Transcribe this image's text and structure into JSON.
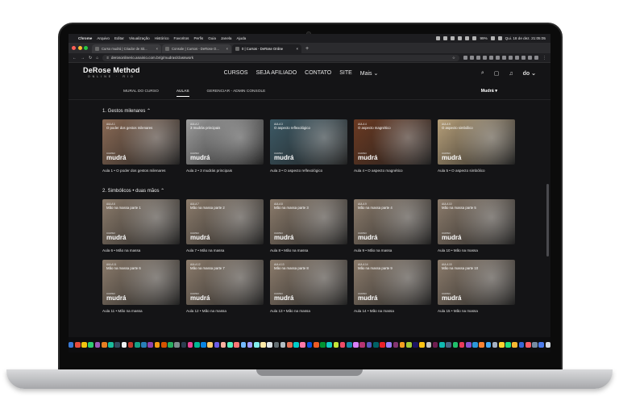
{
  "menubar": {
    "app": "Chrome",
    "items": [
      "Arquivo",
      "Editar",
      "Visualização",
      "Histórico",
      "Favoritos",
      "Perfis",
      "Guia",
      "Janela",
      "Ajuda"
    ],
    "battery": "99%",
    "datetime": "Qui. 18 de dez.  21:05:05"
  },
  "browser": {
    "tabs": [
      {
        "title": "Curso mudrá | Criador de Sit..."
      },
      {
        "title": "Console | Cursos - DeRose O..."
      },
      {
        "title": "0 | Cursos - DeRose Online"
      }
    ],
    "active_tab": 2,
    "url": "derosonlinerio.anainio.com.br/g/mudras/classwork"
  },
  "site": {
    "logo": "DeRose Method",
    "logo_sub": "ONLINE · RIO",
    "nav": [
      "CURSOS",
      "SEJA AFILIADO",
      "CONTATO",
      "SITE"
    ],
    "more": "Mais",
    "user": "do",
    "subnav": [
      "MURAL DO CURSO",
      "AULAS",
      "GERENCIAR - ADMIN CONSOLE"
    ],
    "course_select": "Mudrá"
  },
  "sections": [
    {
      "title": "1. Gestos milenares",
      "rows": [
        [
          {
            "tag": "AULA 1",
            "title": "O poder dos gestos milenares",
            "cur": "CURSO",
            "name": "mudrá",
            "caption": "Aula 1 • O poder dos gestos milenares",
            "color": "#8a6a55"
          },
          {
            "tag": "AULA 2",
            "title": "3 mudrás principais",
            "cur": "CURSO",
            "name": "mudrá",
            "caption": "Aula 2 • 3 mudrás principais",
            "color": "#9c9c9c"
          },
          {
            "tag": "AULA 3",
            "title": "O aspecto reflexológico",
            "cur": "CURSO",
            "name": "mudrá",
            "caption": "Aula 3 • O aspecto reflexológico",
            "color": "#3d5a66"
          },
          {
            "tag": "AULA 4",
            "title": "O aspecto magnético",
            "cur": "CURSO",
            "name": "mudrá",
            "caption": "Aula 4 • O aspecto magnético",
            "color": "#6b3a22"
          },
          {
            "tag": "AULA 5",
            "title": "O aspecto simbólico",
            "cur": "CURSO",
            "name": "mudrá",
            "caption": "Aula 5 • O aspecto simbólico",
            "color": "#b7a07a"
          }
        ]
      ]
    },
    {
      "title": "2. Simbólicos • duas mãos",
      "rows": [
        [
          {
            "tag": "AULA 6",
            "title": "Mão na massa parte 1",
            "cur": "CURSO",
            "name": "mudrá",
            "caption": "Aula 6 • Mão na massa",
            "color": "#8c7c6c"
          },
          {
            "tag": "AULA 7",
            "title": "Mão na massa parte 2",
            "cur": "CURSO",
            "name": "mudrá",
            "caption": "Aula 7 • Mão na massa",
            "color": "#8c7c6c"
          },
          {
            "tag": "AULA 8",
            "title": "Mão na massa parte 3",
            "cur": "CURSO",
            "name": "mudrá",
            "caption": "Aula 8 • Mão na massa",
            "color": "#8c7c6c"
          },
          {
            "tag": "AULA 9",
            "title": "Mão na massa parte 4",
            "cur": "CURSO",
            "name": "mudrá",
            "caption": "Aula 9 • Mão na massa",
            "color": "#8c7c6c"
          },
          {
            "tag": "AULA 10",
            "title": "Mão na massa parte 5",
            "cur": "CURSO",
            "name": "mudrá",
            "caption": "Aula 10 • Mão na massa",
            "color": "#8c7c6c"
          }
        ],
        [
          {
            "tag": "AULA 11",
            "title": "Mão na massa parte 6",
            "cur": "CURSO",
            "name": "mudrá",
            "caption": "Aula 11 • Mão na massa",
            "color": "#8c7c6c"
          },
          {
            "tag": "AULA 12",
            "title": "Mão na massa parte 7",
            "cur": "CURSO",
            "name": "mudrá",
            "caption": "Aula 12 • Mão na massa",
            "color": "#8c7c6c"
          },
          {
            "tag": "AULA 13",
            "title": "Mão na massa parte 8",
            "cur": "CURSO",
            "name": "mudrá",
            "caption": "Aula 13 • Mão na massa",
            "color": "#8c7c6c"
          },
          {
            "tag": "AULA 14",
            "title": "Mão na massa parte 9",
            "cur": "CURSO",
            "name": "mudrá",
            "caption": "Aula 14 • Mão na massa",
            "color": "#8c7c6c"
          },
          {
            "tag": "AULA 15",
            "title": "Mão na massa parte 10",
            "cur": "CURSO",
            "name": "mudrá",
            "caption": "Aula 15 • Mão na massa",
            "color": "#8c7c6c"
          }
        ]
      ]
    }
  ],
  "dock_colors": [
    "#3a7bd5",
    "#e74c3c",
    "#f1c40f",
    "#2ecc71",
    "#9b59b6",
    "#e67e22",
    "#1abc9c",
    "#34495e",
    "#ecf0f1",
    "#c0392b",
    "#16a085",
    "#2980b9",
    "#8e44ad",
    "#f39c12",
    "#d35400",
    "#27ae60",
    "#7f8c8d",
    "#2c3e50",
    "#e84393",
    "#00b894",
    "#0984e3",
    "#fdcb6e",
    "#6c5ce7",
    "#fab1a0",
    "#55efc4",
    "#ff7675",
    "#74b9ff",
    "#a29bfe",
    "#81ecec",
    "#ffeaa7",
    "#dfe6e9",
    "#636e72",
    "#b2bec3",
    "#e17055",
    "#00cec9",
    "#fd79a8",
    "#0652dd",
    "#ee5a24",
    "#009432",
    "#12cbc4",
    "#c4e538",
    "#ed4c67",
    "#1289a7",
    "#d980fa",
    "#b53471",
    "#5758bb",
    "#006266",
    "#ea2027",
    "#9980fa",
    "#833471",
    "#f79f1f",
    "#a3cb38",
    "#1b1464",
    "#ffc312",
    "#c4c4c4",
    "#6f1e51",
    "#0fb9b1",
    "#4b6584",
    "#20bf6b",
    "#eb3b5a",
    "#8854d0",
    "#2d98da",
    "#fa8231",
    "#45aaf2",
    "#a5b1c2",
    "#fed330",
    "#26de81",
    "#f7b731",
    "#3867d6",
    "#fc5c65",
    "#778ca3",
    "#4b7bec",
    "#d1d8e0"
  ]
}
